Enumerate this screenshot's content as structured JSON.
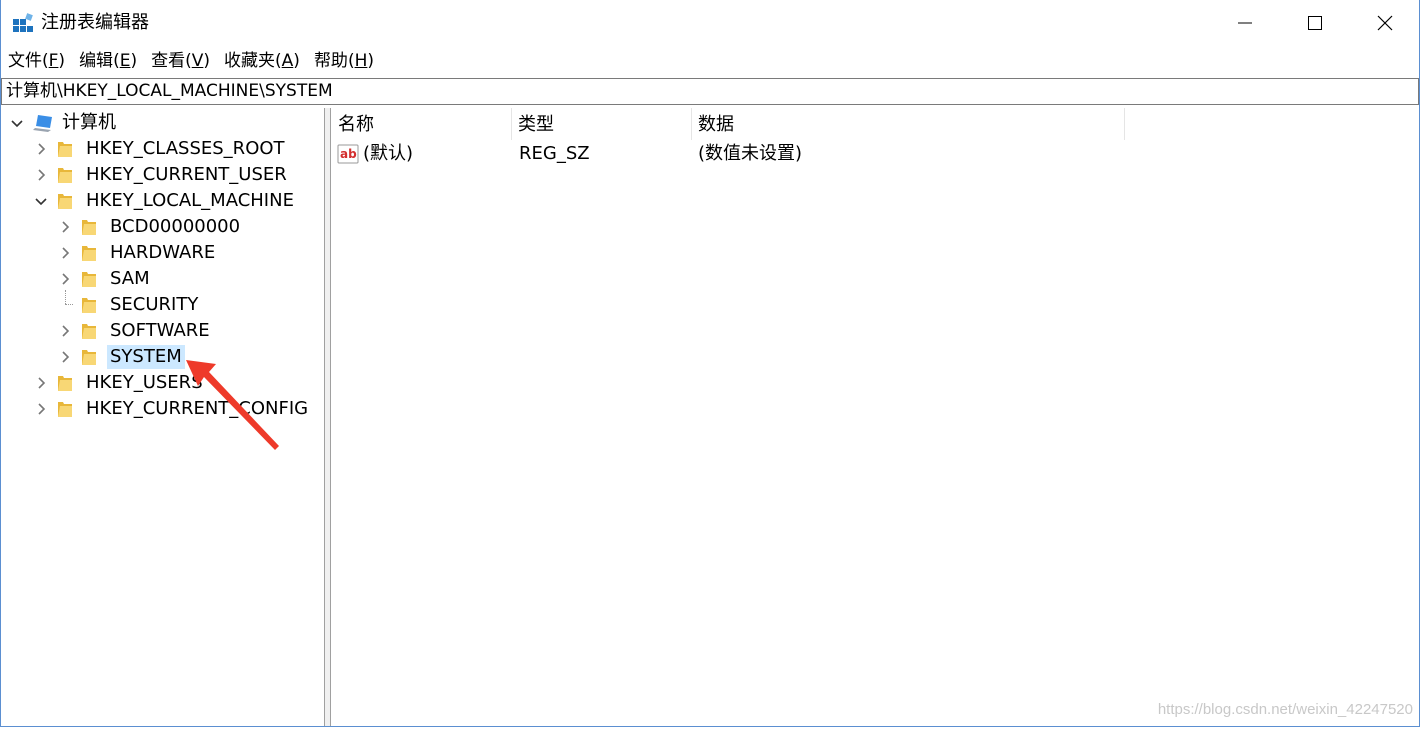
{
  "window": {
    "title": "注册表编辑器",
    "controls": {
      "minimize": "minimize-icon",
      "maximize": "maximize-icon",
      "close": "close-icon"
    }
  },
  "menu": [
    {
      "label": "文件",
      "accel": "F"
    },
    {
      "label": "编辑",
      "accel": "E"
    },
    {
      "label": "查看",
      "accel": "V"
    },
    {
      "label": "收藏夹",
      "accel": "A"
    },
    {
      "label": "帮助",
      "accel": "H"
    }
  ],
  "address": {
    "path": "计算机\\HKEY_LOCAL_MACHINE\\SYSTEM"
  },
  "tree": {
    "root": {
      "label": "计算机",
      "expanded": true,
      "icon": "computer-icon"
    },
    "items": [
      {
        "label": "HKEY_CLASSES_ROOT",
        "level": 1,
        "expander": "collapsed"
      },
      {
        "label": "HKEY_CURRENT_USER",
        "level": 1,
        "expander": "collapsed"
      },
      {
        "label": "HKEY_LOCAL_MACHINE",
        "level": 1,
        "expander": "expanded"
      },
      {
        "label": "BCD00000000",
        "level": 2,
        "expander": "collapsed"
      },
      {
        "label": "HARDWARE",
        "level": 2,
        "expander": "collapsed"
      },
      {
        "label": "SAM",
        "level": 2,
        "expander": "collapsed"
      },
      {
        "label": "SECURITY",
        "level": 2,
        "expander": "none"
      },
      {
        "label": "SOFTWARE",
        "level": 2,
        "expander": "collapsed"
      },
      {
        "label": "SYSTEM",
        "level": 2,
        "expander": "collapsed",
        "selected": true
      },
      {
        "label": "HKEY_USERS",
        "level": 1,
        "expander": "collapsed"
      },
      {
        "label": "HKEY_CURRENT_CONFIG",
        "level": 1,
        "expander": "collapsed"
      }
    ]
  },
  "list": {
    "columns": [
      "名称",
      "类型",
      "数据"
    ],
    "rows": [
      {
        "name": "(默认)",
        "type": "REG_SZ",
        "data": "(数值未设置)",
        "icon": "string-value-icon"
      }
    ]
  },
  "watermark": "https://blog.csdn.net/weixin_42247520",
  "colors": {
    "selection": "#cce8ff",
    "folder": "#f8d775",
    "annotation_arrow": "#ee3a2a",
    "window_border": "#5b8fd1"
  }
}
